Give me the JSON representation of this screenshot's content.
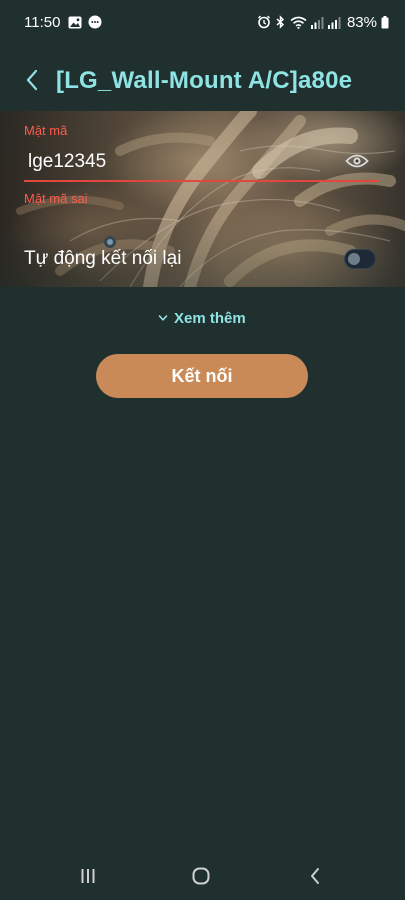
{
  "status_bar": {
    "time": "11:50",
    "battery": "83%",
    "icons": [
      "gallery-icon",
      "chat-bubble-icon",
      "alarm-icon",
      "bluetooth-icon",
      "wifi-icon",
      "signal-icon",
      "signal-icon",
      "battery-icon"
    ]
  },
  "header": {
    "title": "[LG_Wall-Mount A/C]a80e",
    "back_icon": "chevron-left-icon"
  },
  "password": {
    "label": "Mật mã",
    "value": "lge12345",
    "error": "Mật mã sai",
    "visibility_icon": "eye-icon"
  },
  "auto_reconnect": {
    "label": "Tự động kết nối lại",
    "enabled": false
  },
  "see_more": {
    "label": "Xem thêm",
    "icon": "chevron-down-icon"
  },
  "connect_button": {
    "label": "Kết nối"
  },
  "nav_bar": {
    "icons": [
      "recent-apps-icon",
      "home-icon",
      "back-icon"
    ]
  },
  "colors": {
    "background": "#20302f",
    "title_accent": "#8fe3e3",
    "error": "#ff5a4e",
    "button": "#c98a57"
  }
}
